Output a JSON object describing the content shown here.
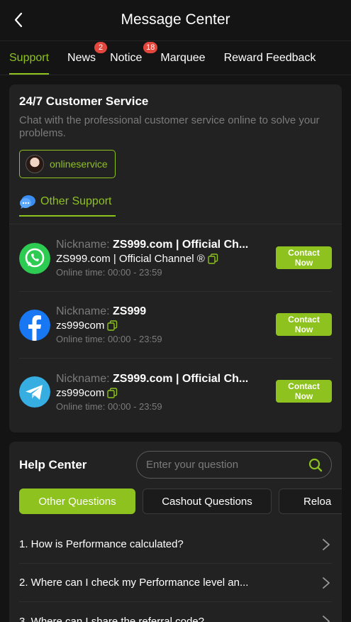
{
  "header": {
    "title": "Message Center",
    "back_icon": "chevron-left-icon"
  },
  "tabs": [
    {
      "label": "Support",
      "active": true,
      "badge": ""
    },
    {
      "label": "News",
      "active": false,
      "badge": "2"
    },
    {
      "label": "Notice",
      "active": false,
      "badge": "18"
    },
    {
      "label": "Marquee",
      "active": false,
      "badge": ""
    },
    {
      "label": "Reward Feedback",
      "active": false,
      "badge": ""
    }
  ],
  "customer_service": {
    "title": "24/7 Customer Service",
    "description": "Chat with the professional customer service online to solve your problems.",
    "online_label": "onlineservice",
    "other_support_label": "Other Support"
  },
  "contacts": [
    {
      "platform": "whatsapp",
      "nickname_label": "Nickname:",
      "nickname": "ZS999.com | Official Ch...",
      "id": "ZS999.com | Official Channel ®",
      "online_time": "Online time: 00:00 - 23:59",
      "button": [
        "Contact",
        "Now"
      ]
    },
    {
      "platform": "facebook",
      "nickname_label": "Nickname:",
      "nickname": "ZS999",
      "id": "zs999com",
      "online_time": "Online time: 00:00 - 23:59",
      "button": [
        "Contact",
        "Now"
      ]
    },
    {
      "platform": "telegram",
      "nickname_label": "Nickname:",
      "nickname": "ZS999.com | Official Ch...",
      "id": "zs999com",
      "online_time": "Online time: 00:00 - 23:59",
      "button": [
        "Contact",
        "Now"
      ]
    }
  ],
  "help_center": {
    "title": "Help Center",
    "search_placeholder": "Enter your question",
    "question_tabs": [
      "Other Questions",
      "Cashout Questions",
      "Reloa"
    ],
    "faq": [
      "1. How is Performance calculated?",
      "2. Where can I check my Performance level an...",
      "3. Where can I share the referral code?"
    ]
  },
  "colors": {
    "accent": "#8dc21f",
    "badge": "#e2473d",
    "background": "#141414",
    "card": "#222222"
  }
}
